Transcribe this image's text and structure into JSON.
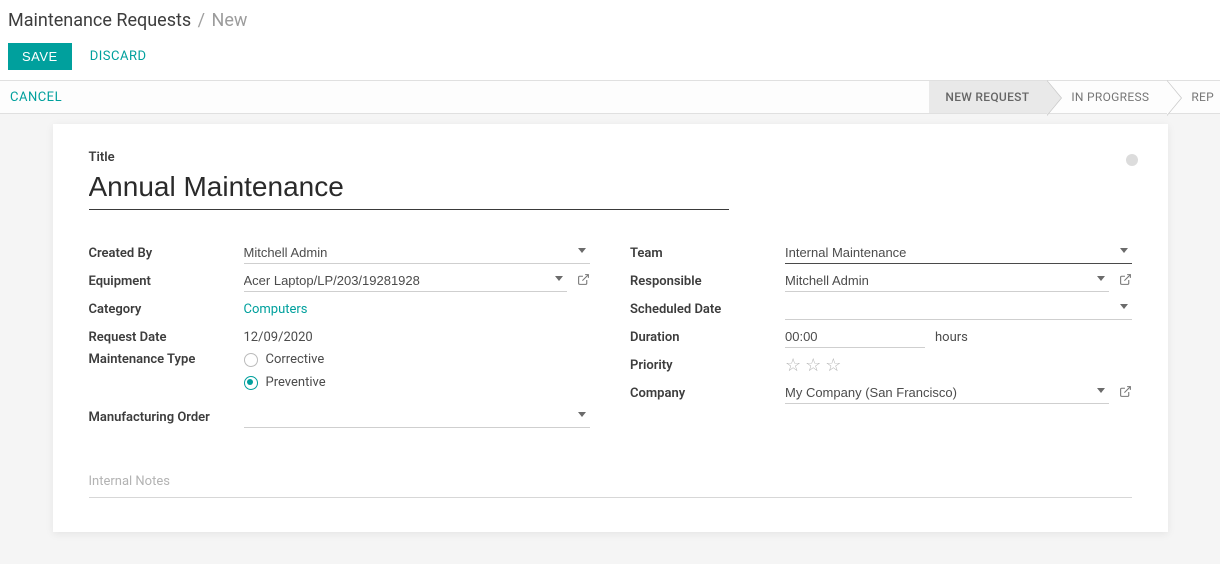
{
  "breadcrumb": {
    "main": "Maintenance Requests",
    "sub": "New"
  },
  "actions": {
    "save": "SAVE",
    "discard": "DISCARD"
  },
  "statusbar": {
    "cancel": "CANCEL",
    "stages": [
      "NEW REQUEST",
      "IN PROGRESS",
      "REP"
    ]
  },
  "form": {
    "title_label": "Title",
    "title_value": "Annual Maintenance",
    "created_by": {
      "label": "Created By",
      "value": "Mitchell Admin"
    },
    "equipment": {
      "label": "Equipment",
      "value": "Acer Laptop/LP/203/19281928"
    },
    "category": {
      "label": "Category",
      "value": "Computers"
    },
    "request_date": {
      "label": "Request Date",
      "value": "12/09/2020"
    },
    "maintenance_type": {
      "label": "Maintenance Type",
      "options": {
        "corrective": "Corrective",
        "preventive": "Preventive"
      },
      "selected": "preventive"
    },
    "manufacturing_order": {
      "label": "Manufacturing Order",
      "value": ""
    },
    "team": {
      "label": "Team",
      "value": "Internal Maintenance"
    },
    "responsible": {
      "label": "Responsible",
      "value": "Mitchell Admin"
    },
    "scheduled_date": {
      "label": "Scheduled Date",
      "value": ""
    },
    "duration": {
      "label": "Duration",
      "value": "00:00",
      "suffix": "hours"
    },
    "priority": {
      "label": "Priority"
    },
    "company": {
      "label": "Company",
      "value": "My Company (San Francisco)"
    },
    "notes_placeholder": "Internal Notes"
  }
}
